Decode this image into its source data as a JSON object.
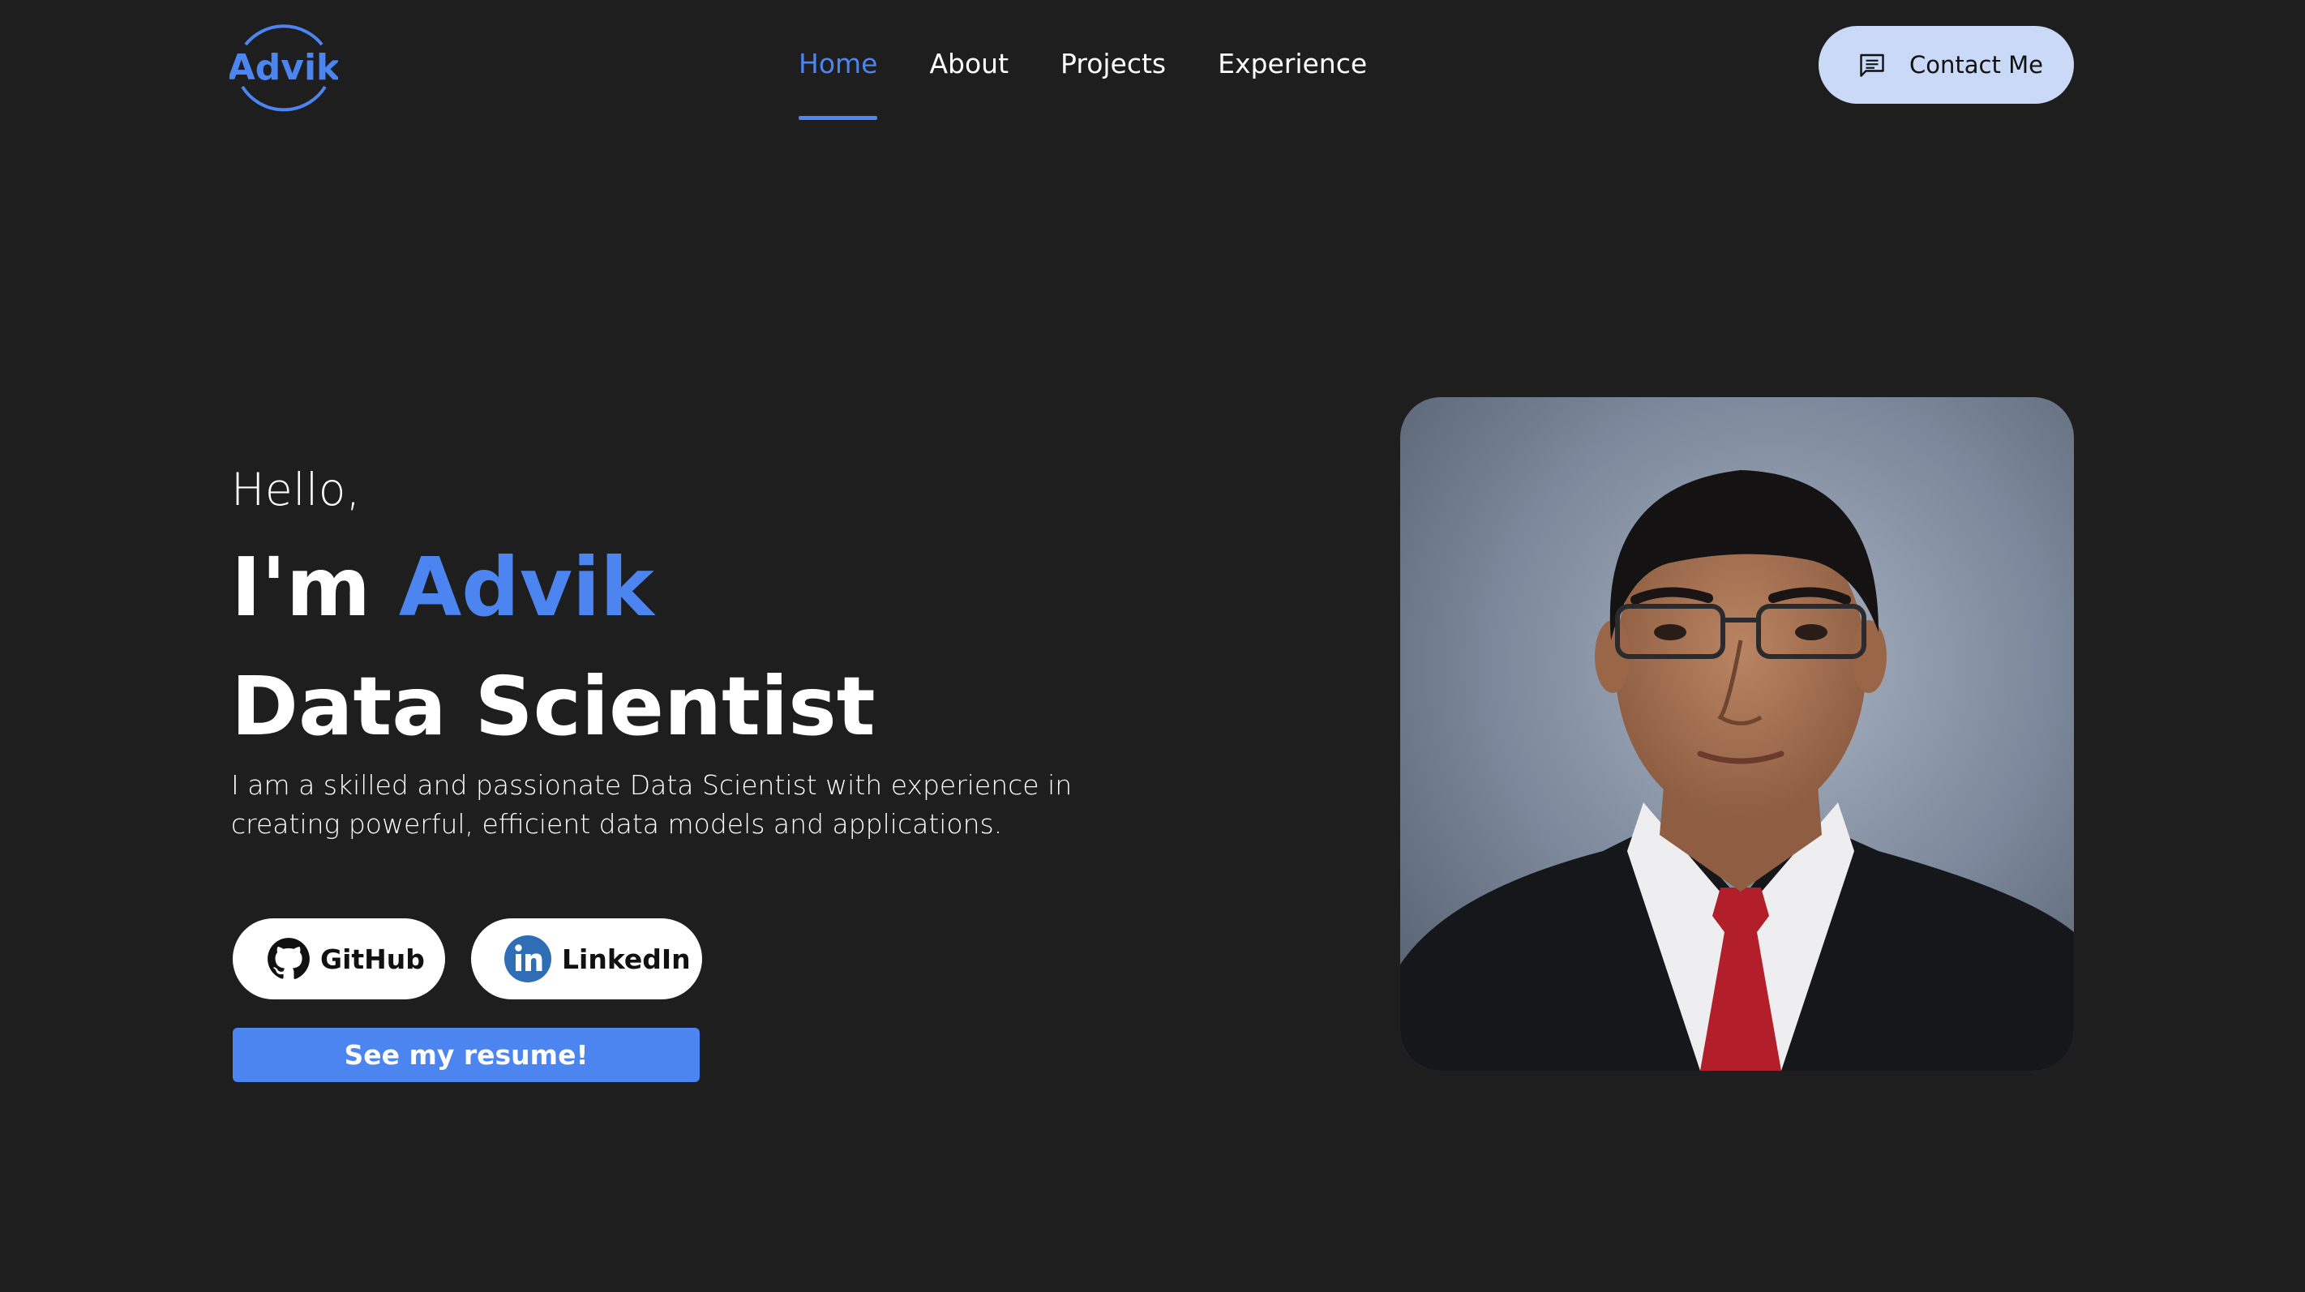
{
  "header": {
    "logo_text": "Advik",
    "nav": [
      {
        "label": "Home",
        "active": true
      },
      {
        "label": "About",
        "active": false
      },
      {
        "label": "Projects",
        "active": false
      },
      {
        "label": "Experience",
        "active": false
      }
    ],
    "contact_label": "Contact Me",
    "contact_icon": "message-icon"
  },
  "hero": {
    "greeting": "Hello,",
    "name_prefix": "I'm",
    "name": "Advik",
    "role": "Data Scientist",
    "description": "I am a skilled and passionate Data Scientist with experience in creating powerful, efficient data models and applications.",
    "buttons": {
      "github_label": "GitHub",
      "github_icon": "github-icon",
      "linkedin_label": "LinkedIn",
      "linkedin_icon": "linkedin-icon",
      "resume_label": "See my resume!"
    },
    "portrait_alt": "profile-photo"
  },
  "colors": {
    "background": "#1e1e1f",
    "accent": "#4c84f0",
    "contact_bg": "#c9d9f7",
    "text": "#ffffff"
  }
}
